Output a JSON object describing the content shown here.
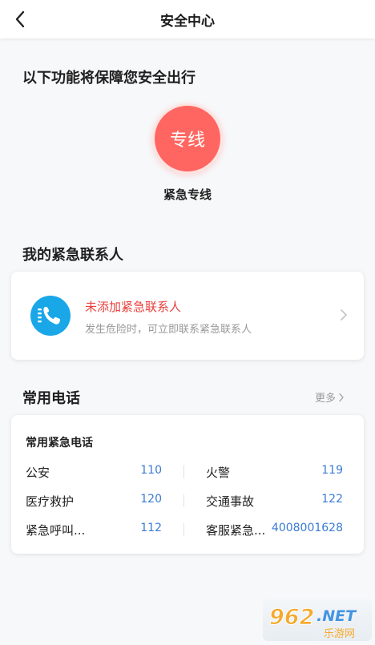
{
  "header": {
    "title": "安全中心"
  },
  "safety": {
    "section_title": "以下功能将保障您安全出行",
    "hotline_button_text": "专线",
    "hotline_label": "紧急专线"
  },
  "contacts": {
    "section_title": "我的紧急联系人",
    "status": "未添加紧急联系人",
    "hint": "发生危险时，可立即联系紧急联系人"
  },
  "phones": {
    "section_title": "常用电话",
    "more_label": "更多",
    "card_title": "常用紧急电话",
    "rows": [
      {
        "left_name": "公安",
        "left_number": "110",
        "right_name": "火警",
        "right_number": "119"
      },
      {
        "left_name": "医疗救护",
        "left_number": "120",
        "right_name": "交通事故",
        "right_number": "122"
      },
      {
        "left_name": "紧急呼叫...",
        "left_number": "112",
        "right_name": "客服紧急...",
        "right_number": "4008001628"
      }
    ]
  },
  "colors": {
    "hotline_red": "#ff6661",
    "contact_alert_red": "#e8413c",
    "phone_icon_blue": "#1aa7e8",
    "number_blue": "#3a7bd5"
  },
  "icons": {
    "back": "back-arrow-icon",
    "phone": "phone-icon",
    "chevron": "chevron-right-icon"
  },
  "watermark": {
    "text": "962.NET",
    "subtext": "乐游网"
  }
}
